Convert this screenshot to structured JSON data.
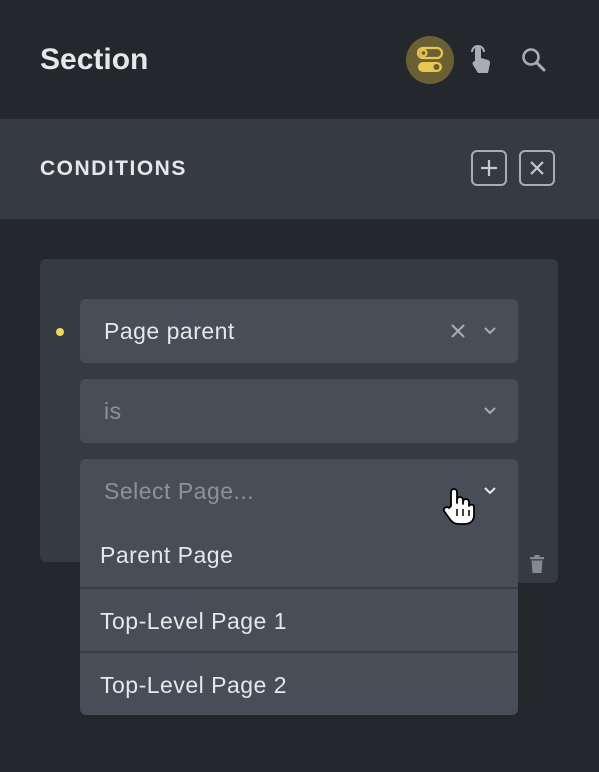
{
  "header": {
    "title": "Section"
  },
  "section": {
    "title": "CONDITIONS",
    "icons": {
      "toggle": "toggles-icon",
      "touch": "pointer-touch-icon",
      "search": "search-icon",
      "add": "plus-icon",
      "close": "close-icon"
    }
  },
  "condition": {
    "key_value": "Page parent",
    "operator_value": "is",
    "value_placeholder": "Select Page...",
    "options": [
      "Parent Page",
      "Top-Level Page 1",
      "Top-Level Page 2"
    ]
  },
  "colors": {
    "accent": "#f2d65c",
    "active_icon_bg": "#6b5f34",
    "panel": "#363b43",
    "field": "#474e58"
  }
}
